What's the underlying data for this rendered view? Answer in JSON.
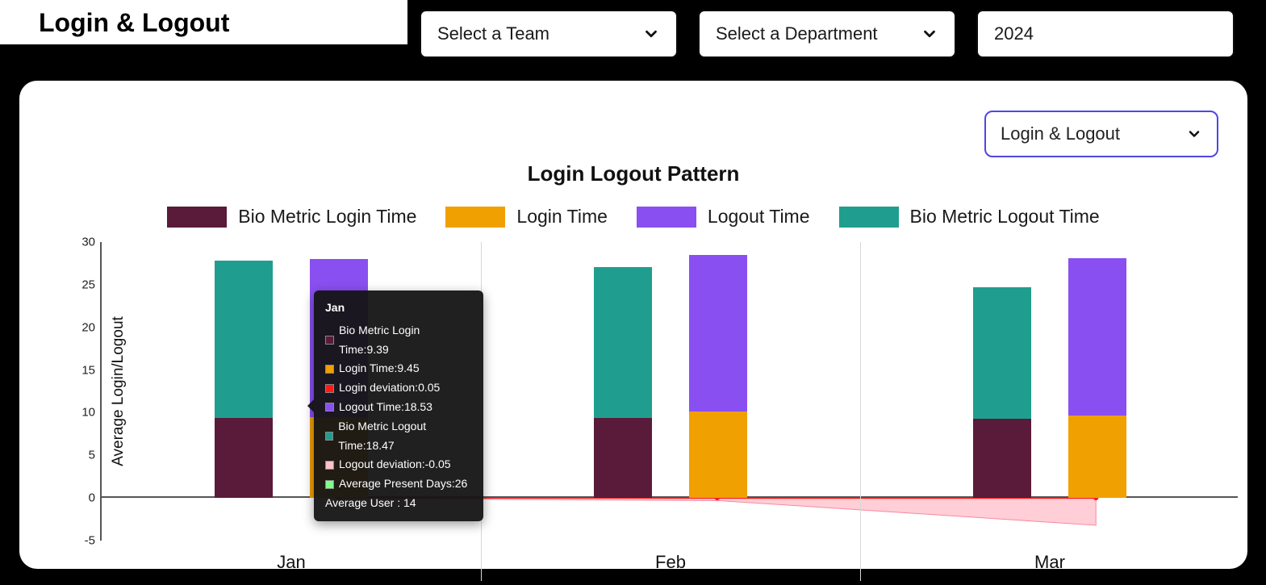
{
  "header": {
    "title": "Login & Logout",
    "team_placeholder": "Select a Team",
    "dept_placeholder": "Select a Department",
    "year_value": "2024"
  },
  "card": {
    "dropdown_value": "Login & Logout",
    "chart_title": "Login Logout Pattern",
    "ylabel": "Average Login/Logout"
  },
  "legend": [
    {
      "label": "Bio Metric Login Time",
      "color": "#5a1a3a"
    },
    {
      "label": "Login Time",
      "color": "#f0a000"
    },
    {
      "label": "Logout Time",
      "color": "#8a4ff0"
    },
    {
      "label": "Bio Metric Logout Time",
      "color": "#1f9e8f"
    }
  ],
  "colors": {
    "bio_login": "#5a1a3a",
    "login": "#f0a000",
    "logout": "#8a4ff0",
    "bio_logout": "#1f9e8f",
    "login_dev": "#ff1a1a",
    "logout_dev": "#ffc2cc",
    "avg_days": "#7fff8a"
  },
  "tooltip": {
    "title": "Jan",
    "rows": [
      {
        "color": "#5a1a3a",
        "text": "Bio Metric Login Time:9.39"
      },
      {
        "color": "#f0a000",
        "text": "Login Time:9.45"
      },
      {
        "color": "#ff1a1a",
        "text": "Login deviation:0.05"
      },
      {
        "color": "#8a4ff0",
        "text": "Logout Time:18.53"
      },
      {
        "color": "#1f9e8f",
        "text": "Bio Metric Logout Time:18.47"
      },
      {
        "color": "#ffc2cc",
        "text": "Logout deviation:-0.05"
      },
      {
        "color": "#7fff8a",
        "text": "Average Present Days:26"
      }
    ],
    "footer": "Average User : 14"
  },
  "chart_data": {
    "type": "bar",
    "title": "Login Logout Pattern",
    "xlabel": "",
    "ylabel": "Average Login/Logout",
    "ylim": [
      -5,
      30
    ],
    "yticks": [
      -5,
      0,
      5,
      10,
      15,
      20,
      25,
      30
    ],
    "categories": [
      "Jan",
      "Feb",
      "Mar"
    ],
    "stacks": [
      {
        "name": "biometric",
        "segments": [
          "bio_login",
          "bio_logout"
        ]
      },
      {
        "name": "system",
        "segments": [
          "login",
          "logout"
        ]
      }
    ],
    "series": [
      {
        "name": "Bio Metric Login Time",
        "key": "bio_login",
        "values": [
          9.39,
          9.34,
          9.29
        ]
      },
      {
        "name": "Bio Metric Logout Time",
        "key": "bio_logout",
        "values": [
          18.47,
          17.75,
          15.4
        ]
      },
      {
        "name": "Login Time",
        "key": "login",
        "values": [
          9.45,
          10.15,
          9.66
        ]
      },
      {
        "name": "Logout Time",
        "key": "logout",
        "values": [
          18.53,
          18.36,
          18.46
        ]
      },
      {
        "name": "Login deviation",
        "key": "login_dev",
        "values": [
          0.05,
          0.0,
          0.0
        ]
      },
      {
        "name": "Logout deviation",
        "key": "logout_dev",
        "values": [
          -0.05,
          -0.3,
          -3.2
        ]
      }
    ],
    "extra": {
      "average_present_days": 26,
      "average_user": 14
    }
  }
}
